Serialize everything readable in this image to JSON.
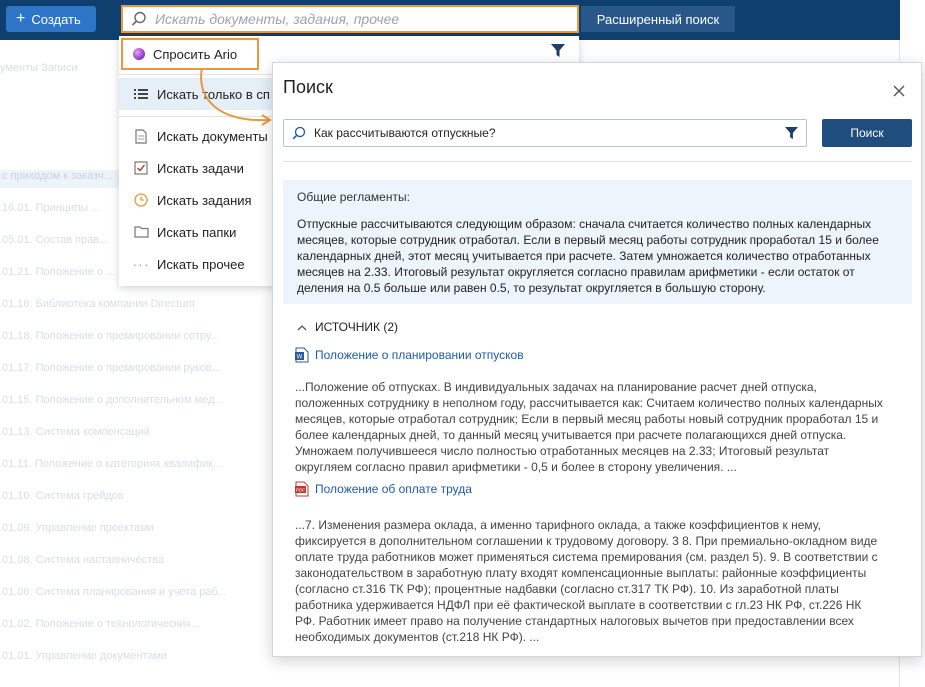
{
  "topbar": {
    "create_label": "Создать",
    "search_placeholder": "Искать документы, задания, прочее",
    "advanced_label": "Расширенный поиск"
  },
  "background": {
    "tabs": "ументы    Записи",
    "rows": [
      "с приходом к заказч...",
      "16.01. Принципы ...",
      "05.01. Состав прав...",
      "01.21. Положение о ...",
      "01.16. Библиотека компании Directum",
      "01.18. Положение о премировании сотру...",
      "01.17. Положение о премировании руков...",
      "01.15. Положение о дополнительном мед...",
      "01.13. Система компенсаций",
      "01.11. Положение о категориях квалифик...",
      "01.10. Система грейдов",
      "01.09. Управление проектами",
      "01.08. Система наставничества",
      "01.06. Система планирования и учета раб...",
      "01.02. Положение о технологических...",
      "01.01. Управление документами"
    ]
  },
  "dropdown": {
    "ario_label": "Спросить Ario",
    "items": [
      {
        "label": "Искать только в сп",
        "icon": "list-icon"
      },
      {
        "label": "Искать документы",
        "icon": "document-icon"
      },
      {
        "label": "Искать задачи",
        "icon": "task-icon"
      },
      {
        "label": "Искать задания",
        "icon": "clock-icon"
      },
      {
        "label": "Искать папки",
        "icon": "folder-icon"
      },
      {
        "label": "Искать прочее",
        "icon": "ellipsis-icon"
      }
    ]
  },
  "panel": {
    "title": "Поиск",
    "query": "Как рассчитываются отпускные?",
    "find_label": "Поиск",
    "answer_heading": "Общие регламенты:",
    "answer_text": "Отпускные рассчитываются следующим образом: сначала считается количество полных календарных месяцев, которые сотрудник отработал. Если в первый месяц работы сотрудник проработал 15 и более календарных дней, этот месяц учитывается при расчете. Затем умножается количество отработанных месяцев на 2.33. Итоговый результат округляется согласно правилам арифметики - если остаток от деления на 0.5 больше или равен 0.5, то результат округляется в большую сторону.",
    "sources_heading": "ИСТОЧНИК (2)",
    "sources": [
      {
        "title": "Положение о планировании отпусков",
        "type": "word",
        "snippet": "...Положение об отпусках. В индивидуальных задачах на планирование расчет дней отпуска, положенных сотруднику в неполном году, рассчитывается как: Считаем количество полных календарных месяцев, которые отработал сотрудник; Если в первый месяц работы новый сотрудник проработал 15 и более календарных дней, то данный месяц учитывается при расчете полагающихся дней отпуска. Умножаем получившееся число полностью отработанных месяцев на 2.33; Итоговый результат округляем согласно правил арифметики - 0,5 и более в сторону увеличения. ..."
      },
      {
        "title": "Положение об оплате труда",
        "type": "pdf",
        "snippet": "...7. Изменения размера оклада, а именно тарифного оклада, а также коэффициентов к нему, фиксируется в дополнительном соглашении к трудовому договору. 3 8. При премиально-окладном виде оплате труда работников может применяться система премирования (см. раздел 5). 9. В соответствии с законодательством в заработную плату входят компенсационные выплаты: районные коэффициенты (согласно ст.316 ТК РФ); процентные надбавки (согласно ст.317 ТК РФ). 10. Из заработной платы работника удерживается НДФЛ при её фактической выплате в соответствии с гл.23 НК РФ, ст.226 НК РФ. Работник имеет право на получение стандартных налоговых вычетов при предоставлении всех необходимых документов (ст.218 НК РФ). ..."
      }
    ]
  },
  "colors": {
    "topbar": "#0f3f6e",
    "accent_orange": "#e8993e",
    "primary_button": "#1e4d7e",
    "link": "#1e5aa8",
    "answer_bg": "#eef4fb"
  }
}
